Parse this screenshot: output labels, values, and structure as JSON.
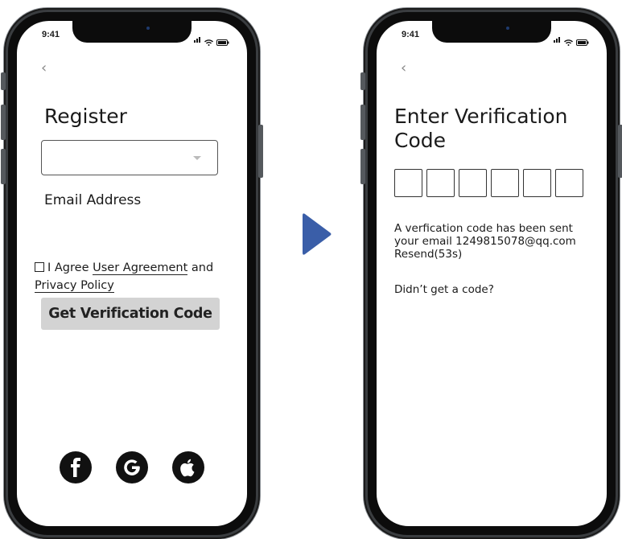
{
  "register_screen": {
    "status_time": "9:41",
    "back_glyph": "‹",
    "title": "Register",
    "email_label": "Email Address",
    "agree_prefix": "I Agree",
    "user_agreement": "User Agreement",
    "and": "and",
    "privacy_policy": "Privacy Policy",
    "verify_button": "Get Verification Code",
    "social": [
      "facebook-icon",
      "google-icon",
      "apple-icon"
    ]
  },
  "verify_screen": {
    "status_time": "9:41",
    "back_glyph": "‹",
    "title_line1": "Enter Verification",
    "title_line2": "Code",
    "message_line1": "A verfication code has been sent",
    "message_line2": "your email 1249815078@qq.com",
    "resend": "Resend(53s)",
    "no_code": "Didn’t get a code?"
  },
  "colors": {
    "arrow": "#3a5ea8",
    "button_bg": "#d3d3d3"
  }
}
